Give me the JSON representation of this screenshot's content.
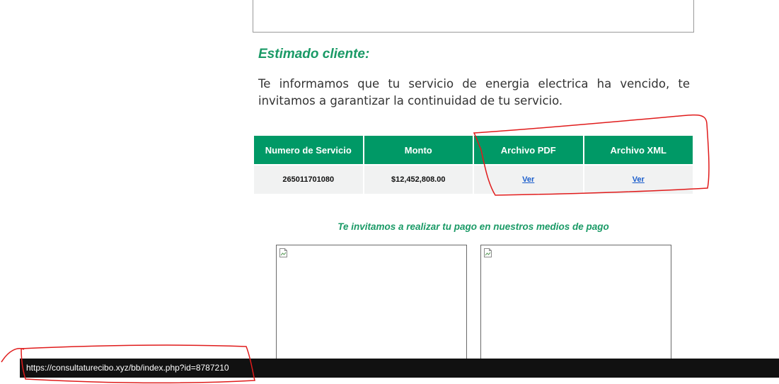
{
  "greeting": "Estimado cliente:",
  "message": "Te informamos que tu servicio de energia electrica ha vencido, te invitamos a garantizar la continuidad de tu servicio.",
  "table": {
    "headers": [
      "Numero de Servicio",
      "Monto",
      "Archivo PDF",
      "Archivo XML"
    ],
    "row": {
      "service_number": "265011701080",
      "amount": "$12,452,808.00",
      "pdf_link": "Ver",
      "xml_link": "Ver"
    }
  },
  "payment_title": "Te invitamos a realizar tu pago en nuestros medios de pago",
  "status_url": "https://consultaturecibo.xyz/bb/index.php?id=8787210",
  "colors": {
    "accent_green": "#009966",
    "title_green": "#1a9a66",
    "link_blue": "#1a5dcc",
    "annotation_red": "#e01b1b"
  }
}
